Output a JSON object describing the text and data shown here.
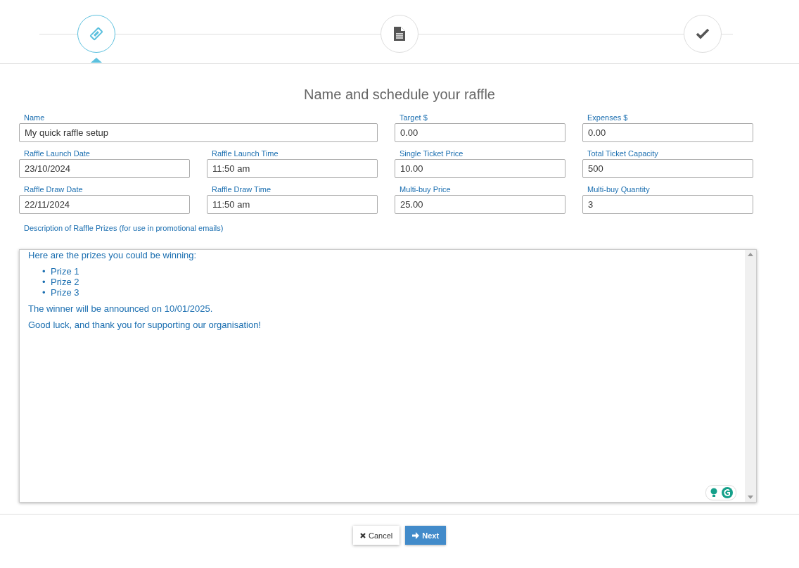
{
  "steps": [
    {
      "kind": "ticket",
      "selected": true
    },
    {
      "kind": "document",
      "selected": false
    },
    {
      "kind": "check",
      "selected": false
    }
  ],
  "title": "Name and schedule your raffle",
  "fields": [
    {
      "label": "Name",
      "value": "My quick raffle setup",
      "kind": "wide"
    },
    {
      "label": "Target $",
      "value": "0.00",
      "kind": "normal"
    },
    {
      "label": "Expenses $",
      "value": "0.00",
      "kind": "normal"
    },
    {
      "label": "Raffle Launch Date",
      "value": "23/10/2024",
      "kind": "normal"
    },
    {
      "label": "Raffle Launch Time",
      "value": "11:50 am",
      "kind": "normal"
    },
    {
      "label": "Single Ticket Price",
      "value": "10.00",
      "kind": "normal"
    },
    {
      "label": "Total Ticket Capacity",
      "value": "500",
      "kind": "normal"
    },
    {
      "label": "Raffle Draw Date",
      "value": "22/11/2024",
      "kind": "normal"
    },
    {
      "label": "Raffle Draw Time",
      "value": "11:50 am",
      "kind": "normal"
    },
    {
      "label": "Multi-buy Price",
      "value": "25.00",
      "kind": "normal"
    },
    {
      "label": "Multi-buy Quantity",
      "value": "3",
      "kind": "normal"
    }
  ],
  "description_label": "Description of Raffle Prizes (for use in promotional emails)",
  "editor": [
    {
      "kind": "paragraph",
      "text": "Here are the prizes you could be winning:"
    },
    {
      "kind": "list",
      "items": [
        {
          "marker": "•",
          "text": "Prize 1"
        },
        {
          "marker": "•",
          "text": "Prize 2"
        },
        {
          "marker": "•",
          "text": "Prize 3"
        }
      ]
    },
    {
      "kind": "paragraph",
      "text": "The winner will be announced on 10/01/2025."
    },
    {
      "kind": "paragraph",
      "text": "Good luck, and thank you for supporting our organisation!"
    }
  ],
  "buttons": [
    {
      "kind": "cancel",
      "label": "Cancel"
    },
    {
      "kind": "next",
      "label": "Next"
    }
  ]
}
